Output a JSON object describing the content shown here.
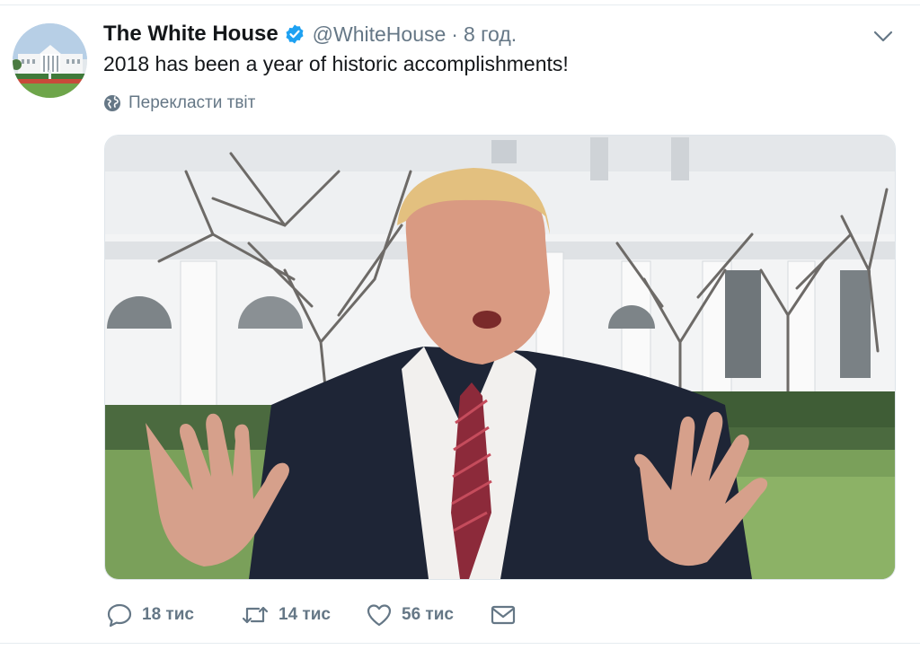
{
  "tweet": {
    "author": {
      "name": "The White House",
      "handle": "@WhiteHouse",
      "verified": true
    },
    "separator": "·",
    "time": "8 год.",
    "text": "2018 has been a year of historic accomplishments!",
    "translate_label": "Перекласти твіт",
    "media": {
      "kind": "video"
    },
    "actions": {
      "replies": "18 тис",
      "retweets": "14 тис",
      "likes": "56 тис"
    }
  },
  "colors": {
    "text_primary": "#14171a",
    "text_secondary": "#657786",
    "verified_blue": "#1da1f2",
    "divider": "#e6ecf0"
  },
  "icons": {
    "verified": "verified-badge-icon",
    "caret": "chevron-down-icon",
    "translate": "globe-icon",
    "reply": "reply-icon",
    "retweet": "retweet-icon",
    "like": "heart-icon",
    "dm": "envelope-icon"
  }
}
